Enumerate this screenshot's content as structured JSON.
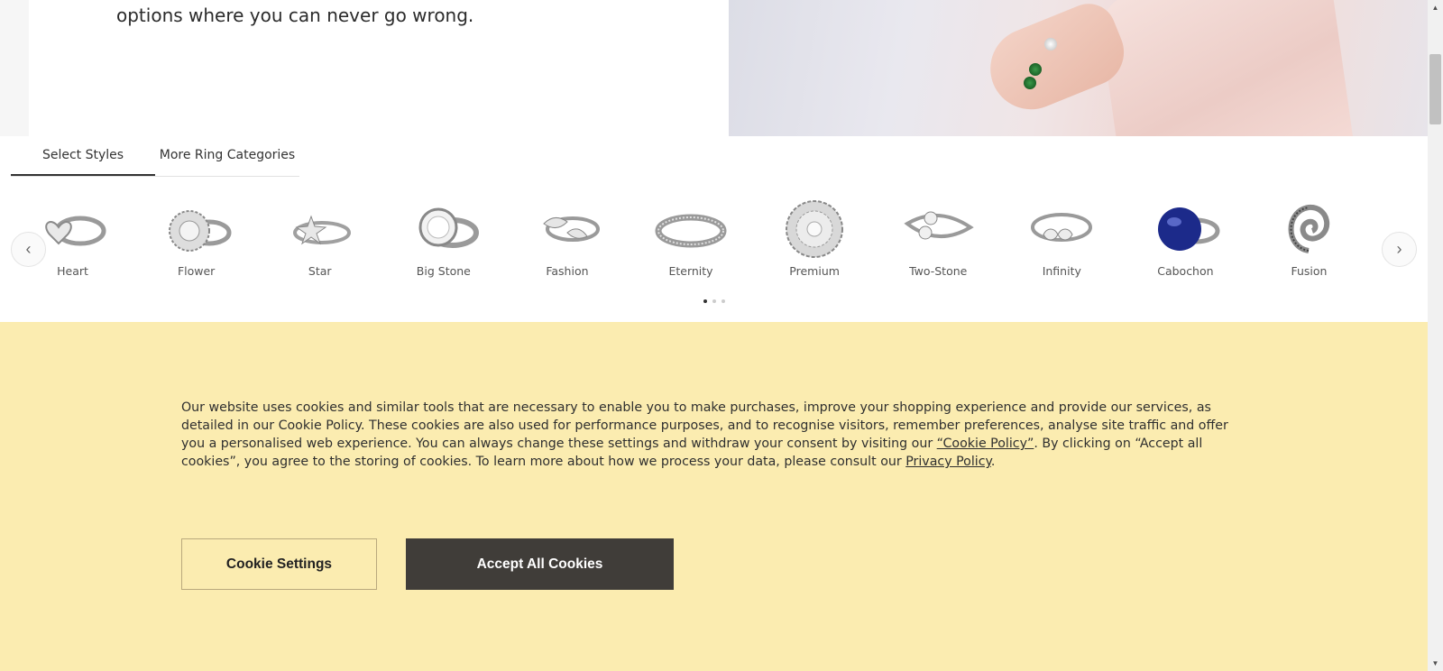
{
  "hero": {
    "text_line": "options where you can never go wrong."
  },
  "tabs": [
    {
      "label": "Select Styles",
      "active": true
    },
    {
      "label": "More Ring Categories",
      "active": false
    }
  ],
  "carousel": {
    "prev_icon": "chevron-left-icon",
    "next_icon": "chevron-right-icon",
    "items": [
      {
        "label": "Heart"
      },
      {
        "label": "Flower"
      },
      {
        "label": "Star"
      },
      {
        "label": "Big Stone"
      },
      {
        "label": "Fashion"
      },
      {
        "label": "Eternity"
      },
      {
        "label": "Premium"
      },
      {
        "label": "Two-Stone"
      },
      {
        "label": "Infinity"
      },
      {
        "label": "Cabochon"
      },
      {
        "label": "Fusion"
      }
    ],
    "page_count": 3,
    "active_page": 1
  },
  "cookie_banner": {
    "text_part1": "Our website uses cookies and similar tools that are necessary to enable you to make purchases, improve your shopping experience and provide our services, as detailed in our Cookie Policy. These cookies are also used for performance purposes, and to recognise visitors, remember preferences, analyse site traffic and offer you a personalised web experience. You can always change these settings and withdraw your consent by visiting our ",
    "cookie_policy_link": "“Cookie Policy”",
    "text_part2": ". By clicking on “Accept all cookies”, you agree to the storing of cookies. To learn more about how we process your data, please consult our ",
    "privacy_policy_link": "Privacy Policy",
    "text_part3": ".",
    "settings_button": "Cookie Settings",
    "accept_button": "Accept All Cookies",
    "background_color": "#fbecb0",
    "accept_button_color": "#403d39"
  }
}
